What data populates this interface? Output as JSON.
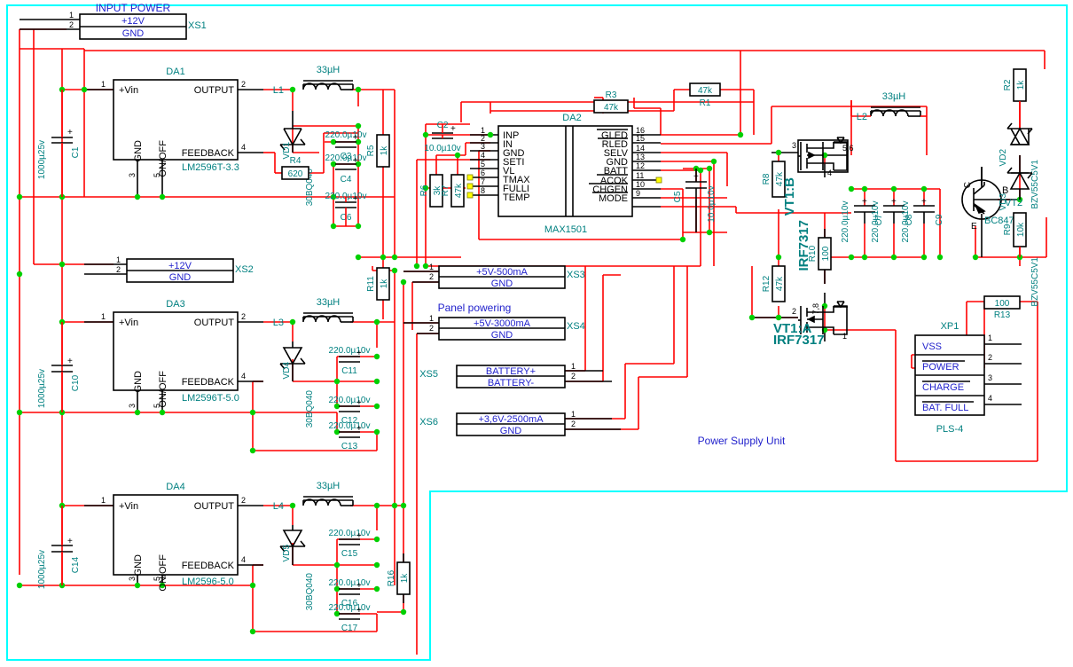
{
  "document": {
    "title": "Power Supply Unit",
    "sheet_note": "Panel powering"
  },
  "connectors": [
    {
      "ref": "XS1",
      "title": "INPUT POWER",
      "rows": [
        "+12V",
        "GND"
      ],
      "pins": [
        "1",
        "2"
      ]
    },
    {
      "ref": "XS2",
      "title": "",
      "rows": [
        "+12V",
        "GND"
      ],
      "pins": [
        "1",
        "2"
      ]
    },
    {
      "ref": "XS3",
      "title": "",
      "rows": [
        "+5V-500mA",
        "GND"
      ],
      "pins": [
        "1",
        "2"
      ]
    },
    {
      "ref": "XS4",
      "title": "",
      "rows": [
        "+5V-3000mA",
        "GND"
      ],
      "pins": [
        "1",
        "2"
      ]
    },
    {
      "ref": "XS5",
      "title": "",
      "rows": [
        "BATTERY+",
        "BATTERY-"
      ],
      "pins": [
        "1",
        "2"
      ]
    },
    {
      "ref": "XS6",
      "title": "",
      "rows": [
        "+3,6V-2500mA",
        "GND"
      ],
      "pins": [
        "1",
        "2"
      ]
    },
    {
      "ref": "XP1",
      "title": "XP1",
      "footprint": "PLS-4",
      "rows": [
        "VSS",
        "POWER",
        "CHARGE",
        "BAT. FULL"
      ],
      "pins": [
        "1",
        "2",
        "3",
        "4"
      ]
    }
  ],
  "regulators": [
    {
      "ref": "DA1",
      "part": "LM2596T-3.3",
      "pins": {
        "vin": "+Vin",
        "output": "OUTPUT",
        "feedback": "FEEDBACK",
        "gnd": "GND",
        "onoff": "ON/OFF"
      },
      "nums": {
        "vin": "1",
        "out": "2",
        "gnd": "3",
        "fb": "4",
        "onoff": "5"
      }
    },
    {
      "ref": "DA3",
      "part": "LM2596T-5.0",
      "pins": {
        "vin": "+Vin",
        "output": "OUTPUT",
        "feedback": "FEEDBACK",
        "gnd": "GND",
        "onoff": "ON/OFF"
      },
      "nums": {
        "vin": "1",
        "out": "2",
        "gnd": "3",
        "fb": "4",
        "onoff": "5"
      }
    },
    {
      "ref": "DA4",
      "part": "LM2596-5.0",
      "pins": {
        "vin": "+Vin",
        "output": "OUTPUT",
        "feedback": "FEEDBACK",
        "gnd": "GND",
        "onoff": "ON/OFF"
      },
      "nums": {
        "vin": "1",
        "out": "2",
        "gnd": "3",
        "fb": "4",
        "onoff": "5"
      }
    }
  ],
  "ic": {
    "ref": "DA2",
    "part": "MAX1501",
    "left_pins": [
      {
        "num": "1",
        "name": "INP",
        "bar": false
      },
      {
        "num": "2",
        "name": "IN",
        "bar": false
      },
      {
        "num": "3",
        "name": "GND",
        "bar": false
      },
      {
        "num": "4",
        "name": "SETI",
        "bar": false
      },
      {
        "num": "5",
        "name": "VL",
        "bar": false
      },
      {
        "num": "6",
        "name": "TMAX",
        "bar": false
      },
      {
        "num": "7",
        "name": "FULLI",
        "bar": false
      },
      {
        "num": "8",
        "name": "TEMP",
        "bar": false
      }
    ],
    "right_pins": [
      {
        "num": "16",
        "name": "GLED",
        "bar": true
      },
      {
        "num": "15",
        "name": "RLED",
        "bar": true
      },
      {
        "num": "14",
        "name": "SELV",
        "bar": false
      },
      {
        "num": "13",
        "name": "GND",
        "bar": false
      },
      {
        "num": "12",
        "name": "BATT",
        "bar": false
      },
      {
        "num": "11",
        "name": "ACOK",
        "bar": true
      },
      {
        "num": "10",
        "name": "CHGEN",
        "bar": true
      },
      {
        "num": "9",
        "name": "MODE",
        "bar": true
      }
    ]
  },
  "inductors": [
    {
      "ref": "L1",
      "value": "33µH"
    },
    {
      "ref": "L2",
      "value": "33µH"
    },
    {
      "ref": "L3",
      "value": "33µH"
    },
    {
      "ref": "L4",
      "value": "33µH"
    }
  ],
  "diodes": [
    {
      "ref": "VD1",
      "part": "30BQ040"
    },
    {
      "ref": "VD4",
      "part": "30BQ040"
    },
    {
      "ref": "VD5",
      "part": "30BQ040"
    },
    {
      "ref": "VD2",
      "part": "BZV55C5V1"
    },
    {
      "ref": "VD3",
      "part": "BZV55C5V1"
    }
  ],
  "transistors": [
    {
      "ref": "VT1:B",
      "part": "IRF7317",
      "pins": [
        "3",
        "5,6",
        "4"
      ]
    },
    {
      "ref": "VT1:A",
      "part": "IRF7317",
      "pins": [
        "2",
        "7,8",
        "1"
      ]
    },
    {
      "ref": "VT2",
      "part": "BC847",
      "pins": [
        "C",
        "B",
        "E"
      ]
    }
  ],
  "resistors": [
    {
      "ref": "R1",
      "value": "47k"
    },
    {
      "ref": "R2",
      "value": "1k"
    },
    {
      "ref": "R3",
      "value": "47k"
    },
    {
      "ref": "R4",
      "value": "620"
    },
    {
      "ref": "R5",
      "value": "1k"
    },
    {
      "ref": "R6",
      "value": "3k"
    },
    {
      "ref": "R7",
      "value": "47k"
    },
    {
      "ref": "R8",
      "value": "47k"
    },
    {
      "ref": "R9",
      "value": "10k"
    },
    {
      "ref": "R10",
      "value": "100"
    },
    {
      "ref": "R11",
      "value": "1k"
    },
    {
      "ref": "R12",
      "value": "47k"
    },
    {
      "ref": "R13",
      "value": "100"
    },
    {
      "ref": "R16",
      "value": "1k"
    }
  ],
  "capacitors": [
    {
      "ref": "C1",
      "value": "1000µ25v"
    },
    {
      "ref": "C2",
      "value": "10.0µ10v"
    },
    {
      "ref": "C3",
      "value": "220.0µ10v"
    },
    {
      "ref": "C4",
      "value": "220.0µ10v"
    },
    {
      "ref": "C5",
      "value": "10.0µ10v"
    },
    {
      "ref": "C6",
      "value": "220.0µ10v"
    },
    {
      "ref": "C7",
      "value": "220.0µ10v"
    },
    {
      "ref": "C8",
      "value": "220.0µ10v"
    },
    {
      "ref": "C9",
      "value": "220.0µ10v"
    },
    {
      "ref": "C10",
      "value": "1000µ25v"
    },
    {
      "ref": "C11",
      "value": "220.0µ10v"
    },
    {
      "ref": "C12",
      "value": "220.0µ10v"
    },
    {
      "ref": "C13",
      "value": "220.0µ10v"
    },
    {
      "ref": "C14",
      "value": "1000µ25v"
    },
    {
      "ref": "C15",
      "value": "220.0µ10v"
    },
    {
      "ref": "C16",
      "value": "220.0µ10v"
    },
    {
      "ref": "C17",
      "value": "220.0µ10v"
    }
  ],
  "colors": {
    "wire": "#ff0000",
    "refdes": "#008080",
    "label": "#2222cc",
    "frame": "#00ffff",
    "junction": "#00d000"
  }
}
